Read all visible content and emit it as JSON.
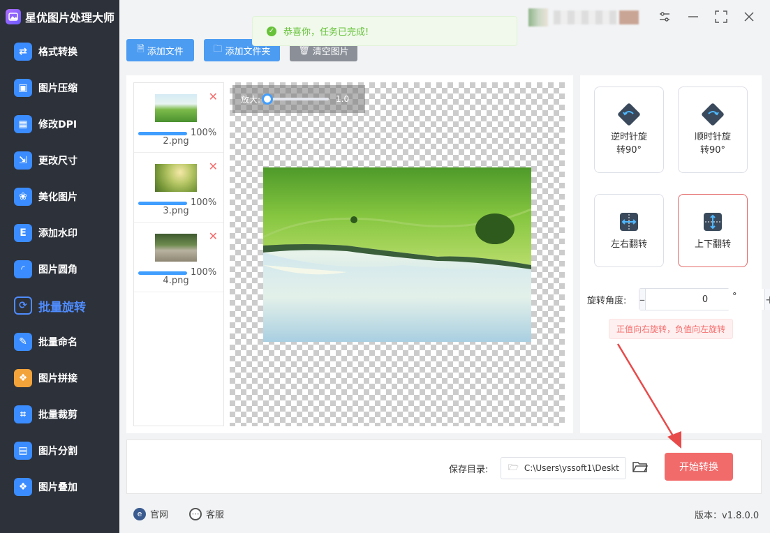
{
  "app": {
    "title": "星优图片处理大师"
  },
  "sidebar": {
    "items": [
      {
        "label": "格式转换",
        "icon": "format-convert-icon"
      },
      {
        "label": "图片压缩",
        "icon": "compress-icon"
      },
      {
        "label": "修改DPI",
        "icon": "dpi-icon"
      },
      {
        "label": "更改尺寸",
        "icon": "resize-icon"
      },
      {
        "label": "美化图片",
        "icon": "beautify-icon"
      },
      {
        "label": "添加水印",
        "icon": "watermark-icon"
      },
      {
        "label": "图片圆角",
        "icon": "round-corner-icon"
      },
      {
        "label": "批量旋转",
        "icon": "rotate-icon",
        "active": true
      },
      {
        "label": "批量命名",
        "icon": "rename-icon"
      },
      {
        "label": "图片拼接",
        "icon": "stitch-icon"
      },
      {
        "label": "批量裁剪",
        "icon": "crop-icon"
      },
      {
        "label": "图片分割",
        "icon": "split-icon"
      },
      {
        "label": "图片叠加",
        "icon": "layers-icon"
      }
    ]
  },
  "toast": {
    "message": "恭喜你，任务已完成!"
  },
  "toolbar": {
    "add_file": "添加文件",
    "add_folder": "添加文件夹",
    "clear": "清空图片"
  },
  "files": [
    {
      "name": "2.png",
      "progress": "100%"
    },
    {
      "name": "3.png",
      "progress": "100%"
    },
    {
      "name": "4.png",
      "progress": "100%"
    }
  ],
  "preview": {
    "zoom_label": "放大:",
    "zoom_value": "1.0"
  },
  "controls": {
    "ccw": {
      "line1": "逆时针旋",
      "line2": "转90°"
    },
    "cw": {
      "line1": "顺时针旋",
      "line2": "转90°"
    },
    "flip_h": "左右翻转",
    "flip_v": "上下翻转",
    "angle_label": "旋转角度:",
    "angle_value": "0",
    "degree_symbol": "°",
    "hint": "正值向右旋转，负值向左旋转"
  },
  "output": {
    "save_label": "保存目录:",
    "path": "C:\\Users\\yssoft1\\Deskt",
    "start": "开始转换"
  },
  "footer": {
    "website": "官网",
    "support": "客服",
    "version": "版本：v1.8.0.0"
  },
  "colors": {
    "sidebar_bg": "#2d3139",
    "accent_blue": "#409eff",
    "start_red": "#f26b6b",
    "success_green": "#67c23a"
  }
}
